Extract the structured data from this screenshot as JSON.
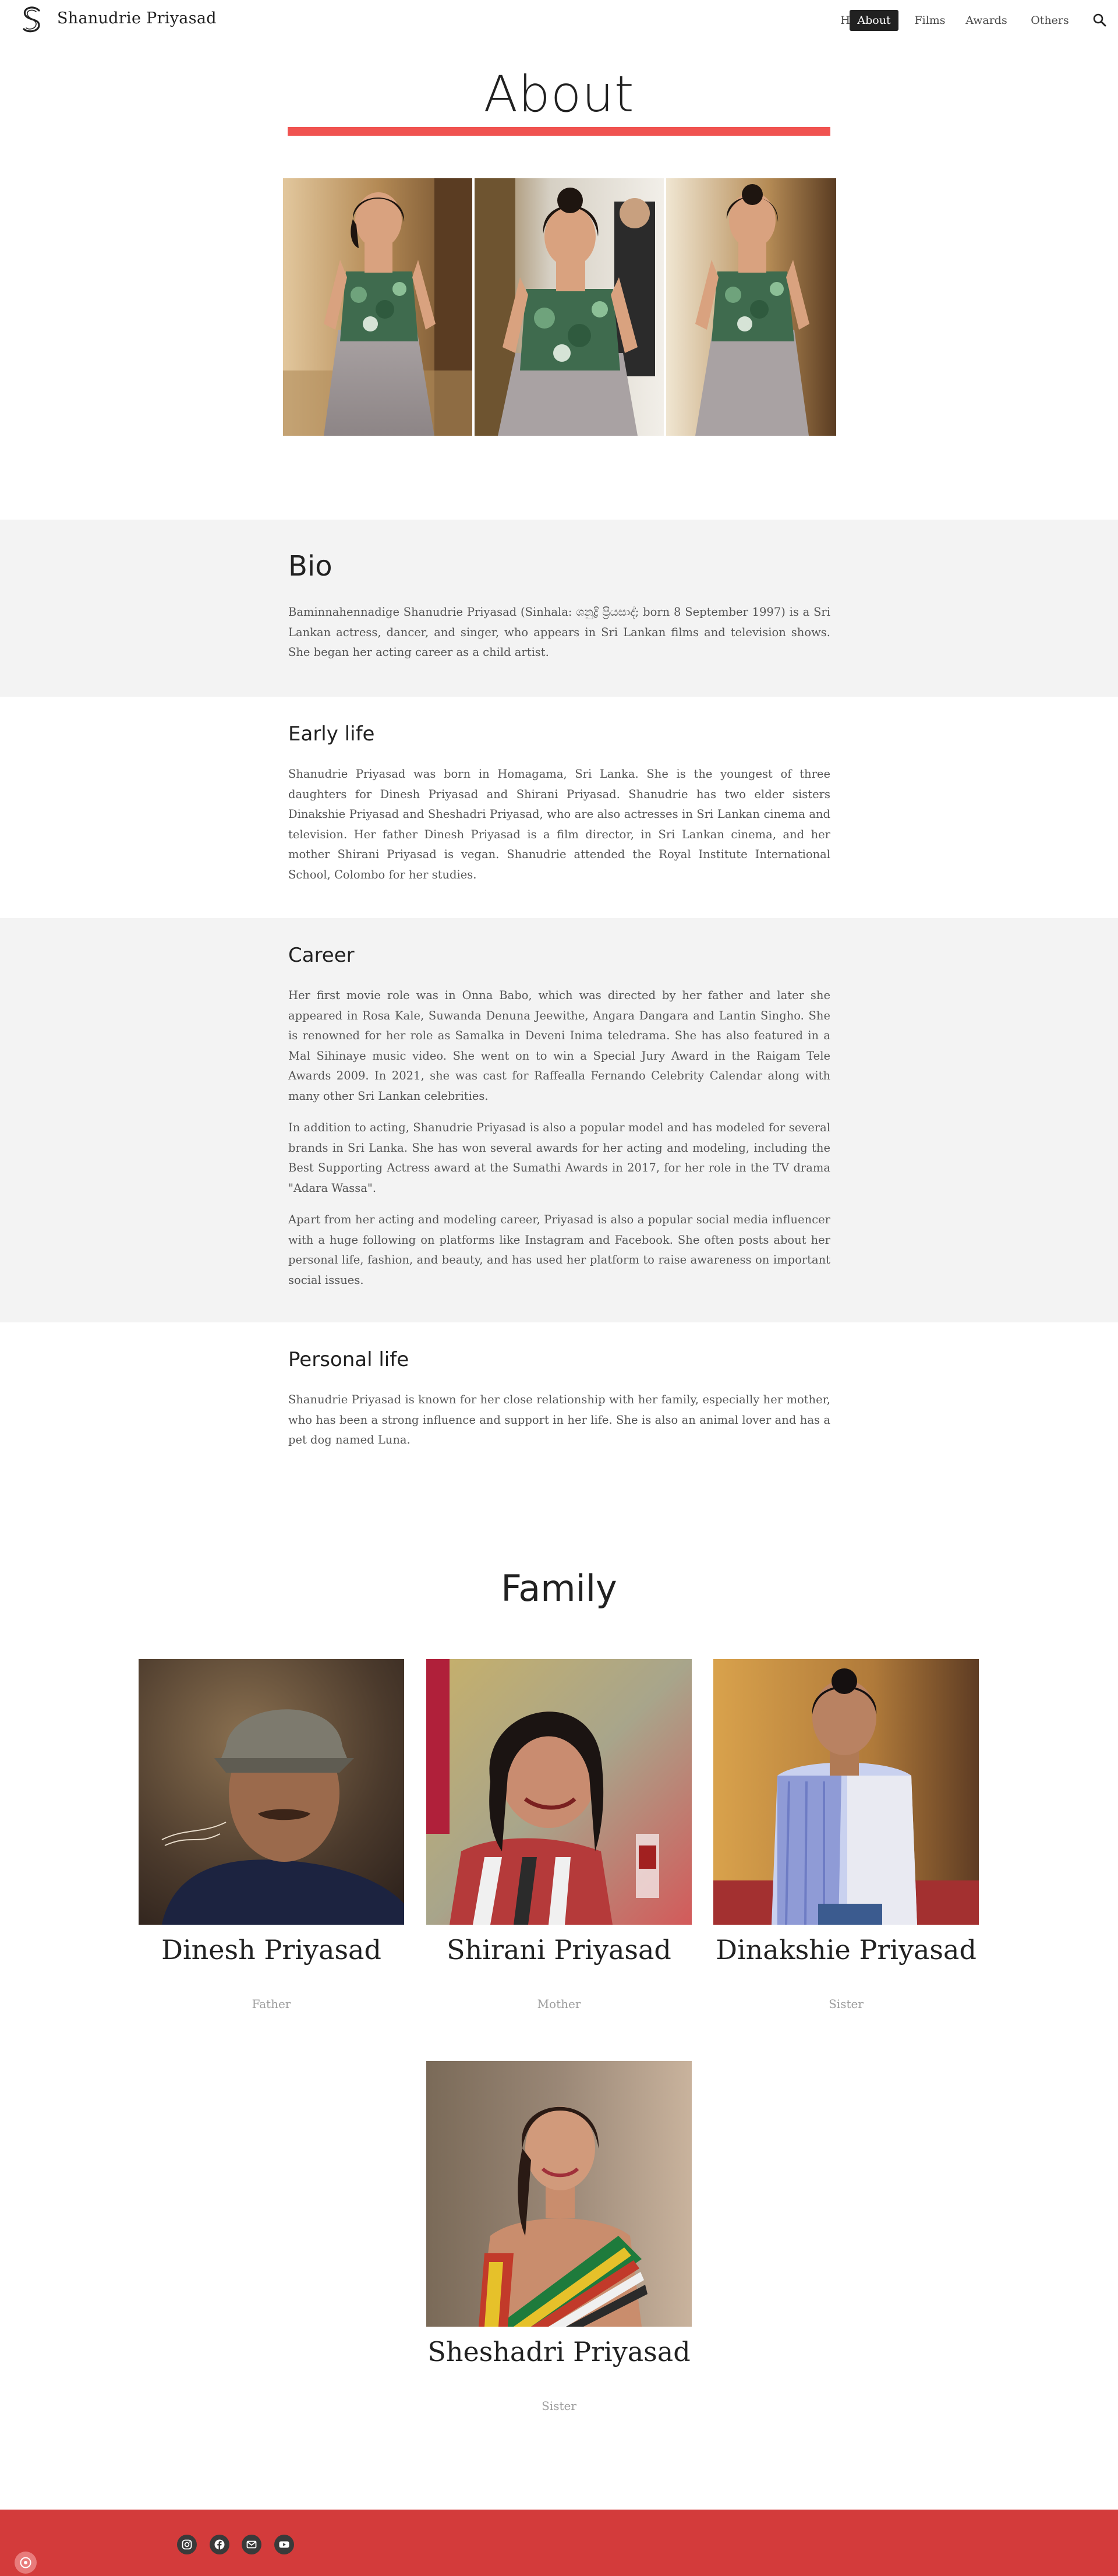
{
  "header": {
    "site_title": "Shanudrie Priyasad",
    "nav": [
      {
        "label": "Home",
        "active": false
      },
      {
        "label": "About",
        "active": true
      },
      {
        "label": "Films",
        "active": false
      },
      {
        "label": "Awards",
        "active": false
      },
      {
        "label": "Others",
        "active": false
      }
    ],
    "search_icon": "search-icon"
  },
  "about": {
    "title": "About",
    "accent_color": "#f05350",
    "hero_photos": [
      "photo-portrait-left",
      "photo-portrait-center",
      "photo-portrait-right"
    ]
  },
  "bio": {
    "heading": "Bio",
    "paragraphs": [
      "Baminnahennadige Shanudrie Priyasad (Sinhala: ශනුද්‍රි ප්‍රියසාද්; born 8 September 1997) is a Sri Lankan actress, dancer, and singer, who appears in Sri Lankan films and television shows. She began her acting career as a child artist."
    ]
  },
  "early_life": {
    "heading": "Early life",
    "paragraphs": [
      "Shanudrie Priyasad was born in Homagama, Sri Lanka. She is the youngest of three daughters for Dinesh Priyasad and Shirani Priyasad. Shanudrie has two elder sisters Dinakshie Priyasad and Sheshadri Priyasad, who are also actresses in Sri Lankan cinema and television. Her father Dinesh Priyasad is a film director, in Sri Lankan cinema, and her mother Shirani Priyasad is vegan. Shanudrie attended the Royal Institute International School, Colombo for her studies."
    ]
  },
  "career": {
    "heading": "Career",
    "paragraphs": [
      "Her first movie role was in Onna Babo, which was directed by her father and later she appeared in Rosa Kale, Suwanda Denuna Jeewithe, Angara Dangara and Lantin Singho. She is renowned for her role as Samalka in Deveni Inima teledrama. She has also featured in a Mal Sihinaye music video. She went on to win a Special Jury Award in the Raigam Tele Awards 2009. In 2021, she was cast for Raffealla Fernando Celebrity Calendar along with many other Sri Lankan celebrities.",
      "In addition to acting, Shanudrie Priyasad is also a popular model and has modeled for several brands in Sri Lanka. She has won several awards for her acting and modeling, including the Best Supporting Actress award at the Sumathi Awards in 2017, for her role in the TV drama \"Adara Wassa\".",
      "Apart from her acting and modeling career, Priyasad is also a popular social media influencer with a huge following on platforms like Instagram and Facebook. She often posts about her personal life, fashion, and beauty, and has used her platform to raise awareness on important social issues."
    ]
  },
  "personal_life": {
    "heading": "Personal life",
    "paragraphs": [
      "Shanudrie Priyasad is known for her close relationship with her family, especially her mother, who has been a strong influence and support in her life. She is also an animal lover and has a pet dog named Luna."
    ]
  },
  "family": {
    "title": "Family",
    "members": [
      {
        "name": "Dinesh Priyasad",
        "relation": "Father"
      },
      {
        "name": "Shirani Priyasad",
        "relation": "Mother"
      },
      {
        "name": "Dinakshie Priyasad",
        "relation": "Sister"
      },
      {
        "name": "Sheshadri Priyasad",
        "relation": "Sister"
      }
    ]
  },
  "footer": {
    "background": "#d33b3b",
    "social_icons": [
      "instagram-icon",
      "facebook-icon",
      "email-icon",
      "youtube-icon"
    ],
    "badge_icon": "info-badge-icon"
  }
}
